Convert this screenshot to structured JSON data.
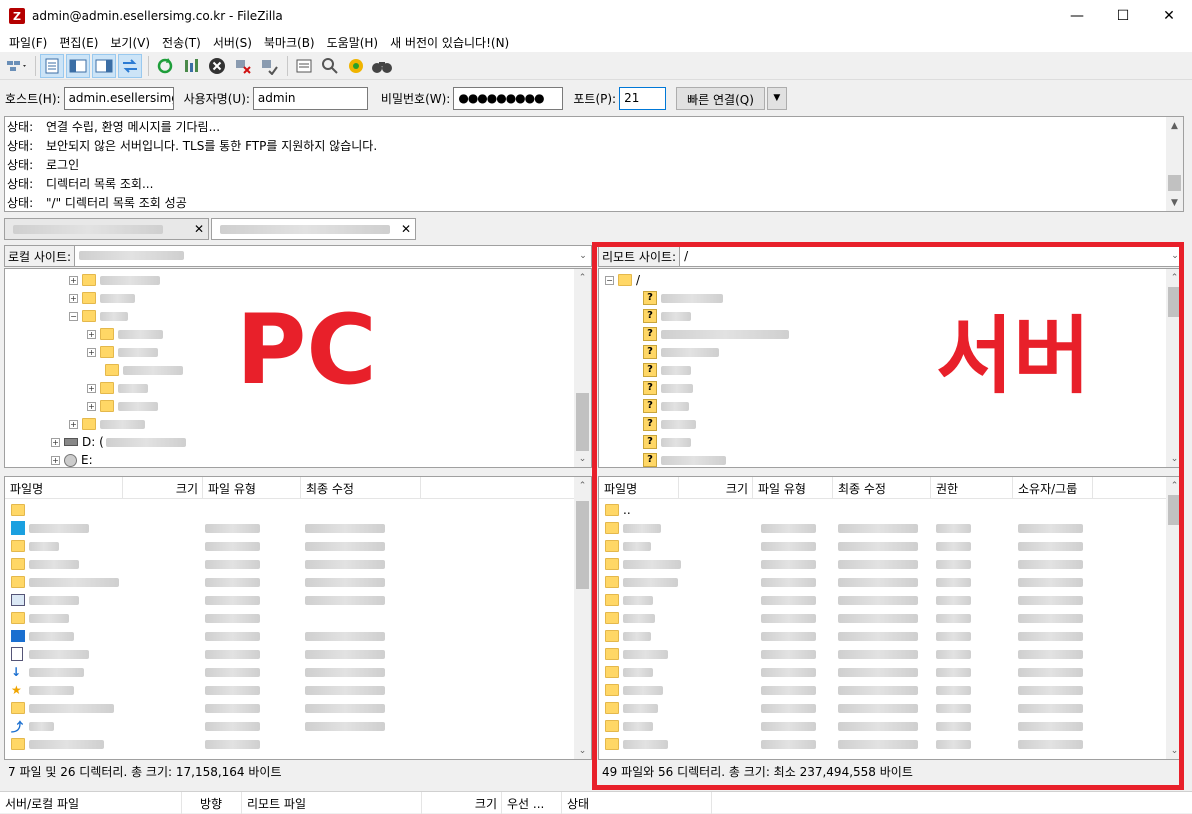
{
  "window": {
    "title": "admin@admin.esellersimg.co.kr - FileZilla",
    "app_icon": "Z"
  },
  "menu": [
    "파일(F)",
    "편집(E)",
    "보기(V)",
    "전송(T)",
    "서버(S)",
    "북마크(B)",
    "도움말(H)",
    "새 버전이 있습니다!(N)"
  ],
  "quickconnect": {
    "host_label": "호스트(H):",
    "host_value": "admin.esellersimg.c",
    "user_label": "사용자명(U):",
    "user_value": "admin",
    "pass_label": "비밀번호(W):",
    "pass_value": "●●●●●●●●●",
    "port_label": "포트(P):",
    "port_value": "21",
    "connect_label": "빠른 연결(Q)"
  },
  "log": [
    {
      "key": "상태:",
      "msg": "연결 수립, 환영 메시지를 기다림..."
    },
    {
      "key": "상태:",
      "msg": "보안되지 않은 서버입니다. TLS를 통한 FTP를 지원하지 않습니다."
    },
    {
      "key": "상태:",
      "msg": "로그인"
    },
    {
      "key": "상태:",
      "msg": "디렉터리 목록 조회..."
    },
    {
      "key": "상태:",
      "msg": "\"/\" 디렉터리 목록 조회 성공"
    }
  ],
  "local": {
    "site_label": "로컬 사이트:",
    "drives": [
      {
        "label": "D: ("
      },
      {
        "label": "E:"
      }
    ],
    "columns": [
      "파일명",
      "크기",
      "파일 유형",
      "최종 수정"
    ],
    "status": "7 파일 및 26 디렉터리. 총 크기: 17,158,164 바이트"
  },
  "remote": {
    "site_label": "리모트 사이트:",
    "site_path": "/",
    "root": "/",
    "columns": [
      "파일명",
      "크기",
      "파일 유형",
      "최종 수정",
      "권한",
      "소유자/그룹"
    ],
    "parent_row": "..",
    "status": "49 파일와 56 디렉터리. 총 크기: 최소 237,494,558 바이트"
  },
  "queue": {
    "columns": [
      "서버/로컬 파일",
      "방향",
      "리모트 파일",
      "크기",
      "우선 ...",
      "상태"
    ]
  },
  "annotations": {
    "local_label": "PC",
    "remote_label": "서버",
    "highlight_color": "#e8202a"
  }
}
